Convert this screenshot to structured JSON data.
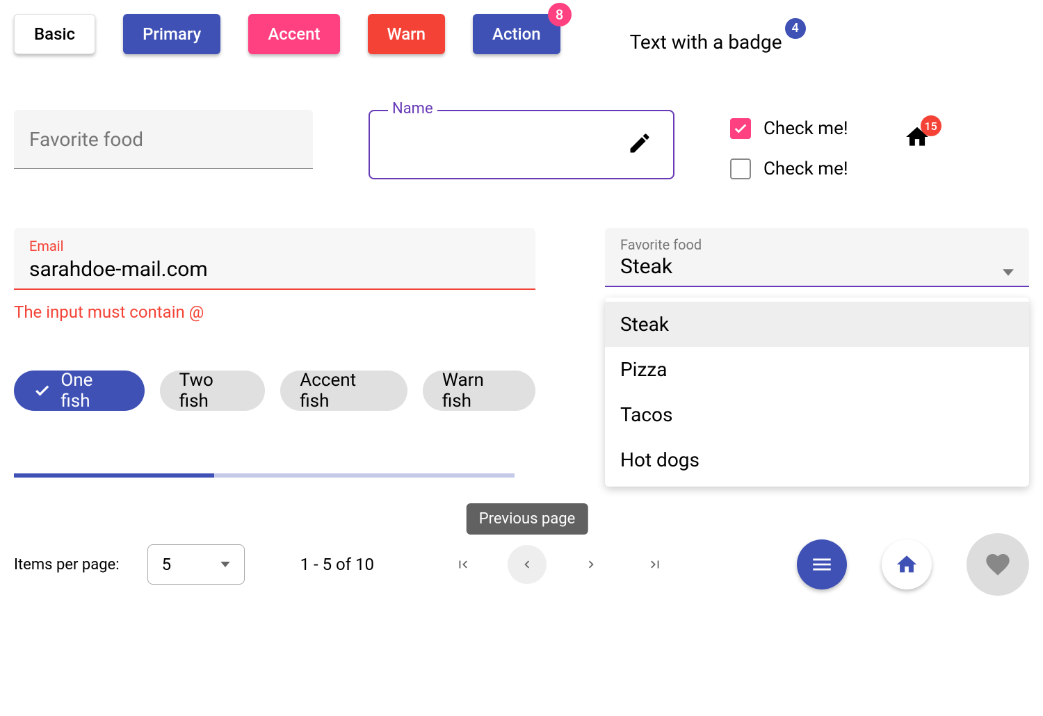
{
  "buttons": {
    "basic": "Basic",
    "primary": "Primary",
    "accent": "Accent",
    "warn": "Warn",
    "action": "Action",
    "action_badge": "8"
  },
  "text_badge": {
    "label": "Text with a badge",
    "count": "4"
  },
  "fav_food_placeholder": "Favorite food",
  "name_label": "Name",
  "checks": {
    "label1": "Check me!",
    "label2": "Check me!"
  },
  "home_badge": "15",
  "email": {
    "label": "Email",
    "value": "sarahdoe-mail.com",
    "error": "The input must contain @"
  },
  "select": {
    "label": "Favorite food",
    "value": "Steak",
    "options": [
      "Steak",
      "Pizza",
      "Tacos",
      "Hot dogs"
    ]
  },
  "chips": [
    "One fish",
    "Two fish",
    "Accent fish",
    "Warn fish"
  ],
  "paginator": {
    "items_label": "Items per page:",
    "page_size": "5",
    "range": "1 - 5 of 10",
    "tooltip": "Previous page"
  }
}
